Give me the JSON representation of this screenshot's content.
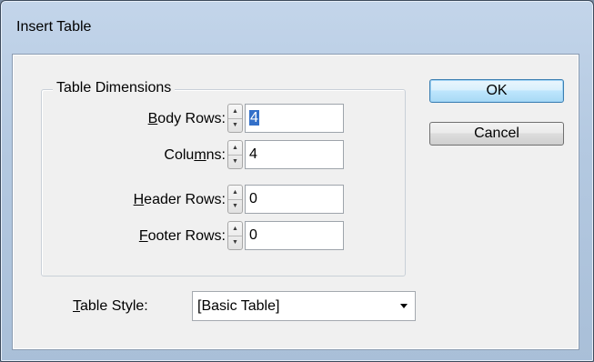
{
  "window": {
    "title": "Insert Table"
  },
  "group": {
    "legend": "Table Dimensions"
  },
  "fields": [
    {
      "label_pre": "",
      "label_key": "B",
      "label_post": "ody Rows:",
      "value": "4",
      "selected": true
    },
    {
      "label_pre": "Colu",
      "label_key": "m",
      "label_post": "ns:",
      "value": "4",
      "selected": false
    },
    {
      "label_pre": "",
      "label_key": "H",
      "label_post": "eader Rows:",
      "value": "0",
      "selected": false
    },
    {
      "label_pre": "",
      "label_key": "F",
      "label_post": "ooter Rows:",
      "value": "0",
      "selected": false
    }
  ],
  "table_style": {
    "label_key": "T",
    "label_post": "able Style:",
    "value": "[Basic Table]"
  },
  "buttons": {
    "ok": "OK",
    "cancel": "Cancel"
  },
  "icons": {
    "spin_up": "up-arrow-icon",
    "spin_down": "down-arrow-icon",
    "dropdown": "chevron-down-icon"
  },
  "colors": {
    "selection": "#3370c9",
    "default_button_border": "#3c7fb1",
    "frame": "#b4c9e1"
  }
}
